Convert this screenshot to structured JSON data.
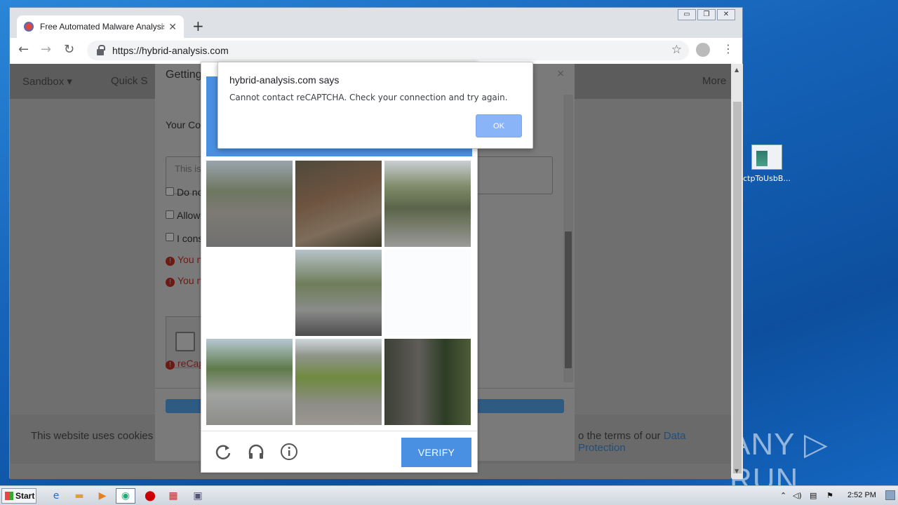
{
  "desktop": {
    "icon_label": "ctpToUsbB...",
    "watermark": "ANY ▷ RUN"
  },
  "browser": {
    "tab_title": "Free Automated Malware Analysis S",
    "tab_close": "✕",
    "new_tab": "+",
    "window_controls": [
      "▭",
      "❐",
      "✕"
    ],
    "url": "https://hybrid-analysis.com",
    "back": "←",
    "forward": "→",
    "reload": "↻",
    "star": "☆",
    "menu": "⋮"
  },
  "site": {
    "nav": {
      "sandbox": "Sandbox ▾",
      "quick": "Quick S",
      "more": "More"
    },
    "cookie_left": "This website uses cookies to",
    "cookie_right": "o the terms of our ",
    "cookie_link": "Data Protection"
  },
  "modal": {
    "title": "Getting",
    "close": "×",
    "your_label": "Your Con",
    "textarea_placeholder": "This is",
    "check1": "Do no",
    "check2": "Allow",
    "check3": "I cons",
    "error1": "You n",
    "error2": "You n",
    "recaptcha_error": "reCap",
    "err_icon": "!"
  },
  "captcha": {
    "verify_label": "VERIFY",
    "icons": [
      "reload-icon",
      "headphones-icon",
      "info-icon"
    ]
  },
  "alert": {
    "title": "hybrid-analysis.com says",
    "message": "Cannot contact reCAPTCHA. Check your connection and try again.",
    "ok_label": "OK"
  },
  "taskbar": {
    "start_label": "Start",
    "tray_expand": "⌃",
    "clock": "2:52 PM"
  }
}
